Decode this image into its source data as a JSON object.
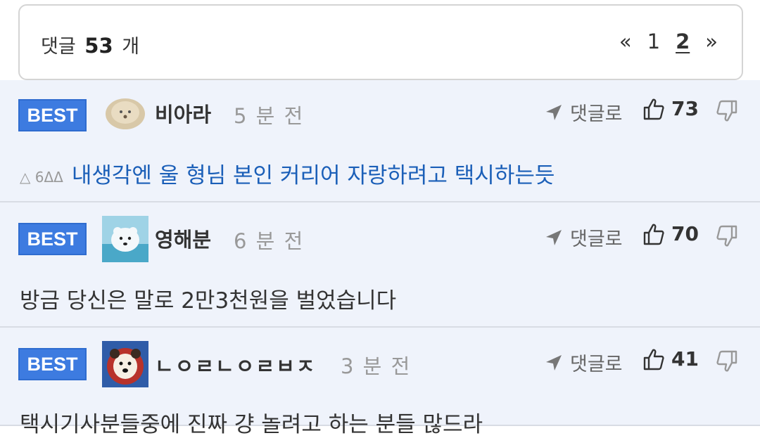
{
  "header": {
    "count_prefix": "댓글",
    "count": "53",
    "count_suffix": "개",
    "pager": {
      "prev": "«",
      "pages": [
        "1",
        "2"
      ],
      "current": "2",
      "next": "»"
    }
  },
  "comments": [
    {
      "badge": "BEST",
      "nickname": "비아라",
      "time": "5 분 전",
      "reply_label": "댓글로",
      "likes": "73",
      "tags": "△ 6ΔΔ",
      "text": "내생각엔 울 형님 본인 커리어 자랑하려고 택시하는듯"
    },
    {
      "badge": "BEST",
      "nickname": "영해분",
      "time": "6 분 전",
      "reply_label": "댓글로",
      "likes": "70",
      "text": "방금 당신은 말로 2만3천원을 벌었습니다"
    },
    {
      "badge": "BEST",
      "nickname": "ㄴㅇㄹㄴㅇㄹㅂㅈ",
      "time": "3 분 전",
      "reply_label": "댓글로",
      "likes": "41",
      "text": "택시기사분들중에 진짜 걍 놀려고 하는 분들 많드라"
    }
  ],
  "colors": {
    "best_badge": "#3d7be0",
    "link_text": "#1b5fb8",
    "comment_bg": "#eff3fb"
  }
}
